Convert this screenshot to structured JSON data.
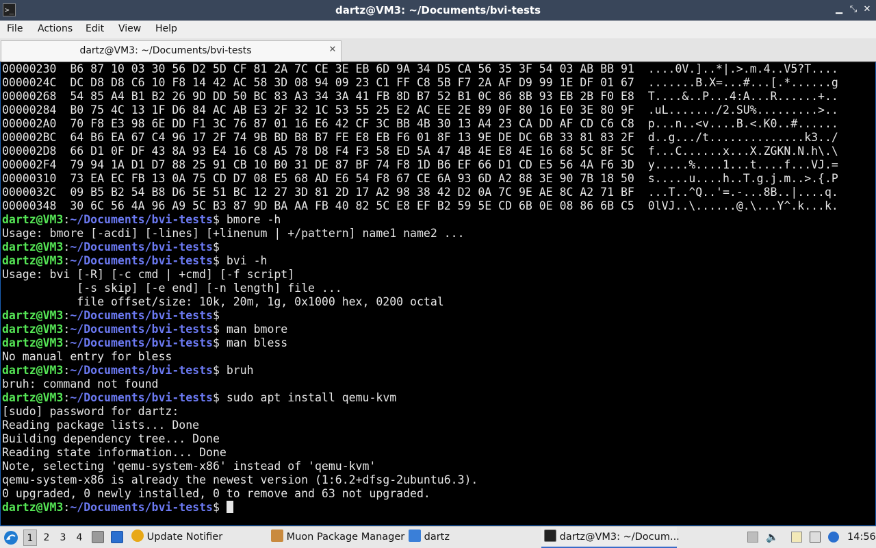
{
  "window": {
    "title": "dartz@VM3: ~/Documents/bvi-tests",
    "app_icon": "terminal-icon",
    "controls": [
      "minimize-icon",
      "maximize-icon",
      "close-icon"
    ]
  },
  "menu": [
    "File",
    "Actions",
    "Edit",
    "View",
    "Help"
  ],
  "tab": {
    "label": "dartz@VM3: ~/Documents/bvi-tests",
    "close_icon": "close-icon"
  },
  "prompt": {
    "user": "dartz@VM3",
    "sep": ":",
    "path": "~/Documents/bvi-tests",
    "dollar": "$"
  },
  "hex_lines": [
    "00000230  B6 87 10 03 30 56 D2 5D CF 81 2A 7C CE 3E EB 6D 9A 34 D5 CA 56 35 3F 54 03 AB BB 91  ....0V.]..*|.>.m.4..V5?T....",
    "0000024C  DC D8 D8 C6 10 F8 14 42 AC 58 3D 08 94 09 23 C1 FF C8 5B F7 2A AF D9 99 1E DF 01 67  .......B.X=...#...[.*......g",
    "00000268  54 85 A4 B1 B2 26 9D DD 50 BC 83 A3 34 3A 41 FB 8D B7 52 B1 0C 86 8B 93 EB 2B F0 E8  T....&..P...4:A...R......+..",
    "00000284  B0 75 4C 13 1F D6 84 AC AB E3 2F 32 1C 53 55 25 E2 AC EE 2E 89 0F 80 16 E0 3E 80 9F  .uL......./2.SU%.........>..",
    "000002A0  70 F8 E3 98 6E DD F1 3C 76 87 01 16 E6 42 CF 3C BB 4B 30 13 A4 23 CA DD AF CD C6 C8  p...n..<v....B.<.K0..#......",
    "000002BC  64 B6 EA 67 C4 96 17 2F 74 9B BD B8 B7 FE E8 EB F6 01 8F 13 9E DE DC 6B 33 81 83 2F  d..g.../t..............k3../",
    "000002D8  66 D1 0F DF 43 8A 93 E4 16 C8 A5 78 D8 F4 F3 58 ED 5A 47 4B 4E E8 4E 16 68 5C 8F 5C  f...C......x...X.ZGKN.N.h\\.\\",
    "000002F4  79 94 1A D1 D7 88 25 91 CB 10 B0 31 DE 87 BF 74 F8 1D B6 EF 66 D1 CD E5 56 4A F6 3D  y.....%....1...t....f...VJ.=",
    "00000310  73 EA EC FB 13 0A 75 CD D7 08 E5 68 AD E6 54 F8 67 CE 6A 93 6D A2 88 3E 90 7B 18 50  s.....u....h..T.g.j.m..>.{.P",
    "0000032C  09 B5 B2 54 B8 D6 5E 51 BC 12 27 3D 81 2D 17 A2 98 38 42 D2 0A 7C 9E AE 8C A2 71 BF  ...T..^Q..'=.-...8B..|....q.",
    "00000348  30 6C 56 4A 96 A9 5C B3 87 9D BA AA FB 40 82 5C E8 EF B2 59 5E CD 6B 0E 08 86 6B C5  0lVJ..\\......@.\\...Y^.k...k."
  ],
  "session": [
    {
      "type": "prompt",
      "cmd": " bmore -h"
    },
    {
      "type": "out",
      "text": "Usage: bmore [-acdi] [-lines] [+linenum | +/pattern] name1 name2 ..."
    },
    {
      "type": "prompt",
      "cmd": ""
    },
    {
      "type": "prompt",
      "cmd": " bvi -h"
    },
    {
      "type": "out",
      "text": "Usage: bvi [-R] [-c cmd | +cmd] [-f script]"
    },
    {
      "type": "out",
      "text": "           [-s skip] [-e end] [-n length] file ..."
    },
    {
      "type": "out",
      "text": "           file offset/size: 10k, 20m, 1g, 0x1000 hex, 0200 octal"
    },
    {
      "type": "prompt",
      "cmd": ""
    },
    {
      "type": "prompt",
      "cmd": " man bmore"
    },
    {
      "type": "prompt",
      "cmd": " man bless"
    },
    {
      "type": "out",
      "text": "No manual entry for bless"
    },
    {
      "type": "prompt",
      "cmd": " bruh"
    },
    {
      "type": "out",
      "text": "bruh: command not found"
    },
    {
      "type": "prompt",
      "cmd": " sudo apt install qemu-kvm"
    },
    {
      "type": "out",
      "text": "[sudo] password for dartz:"
    },
    {
      "type": "out",
      "text": "Reading package lists... Done"
    },
    {
      "type": "out",
      "text": "Building dependency tree... Done"
    },
    {
      "type": "out",
      "text": "Reading state information... Done"
    },
    {
      "type": "out",
      "text": "Note, selecting 'qemu-system-x86' instead of 'qemu-kvm'"
    },
    {
      "type": "out",
      "text": "qemu-system-x86 is already the newest version (1:6.2+dfsg-2ubuntu6.3)."
    },
    {
      "type": "out",
      "text": "0 upgraded, 0 newly installed, 0 to remove and 63 not upgraded."
    },
    {
      "type": "prompt",
      "cmd": " ",
      "cursor": true
    }
  ],
  "taskbar": {
    "start_icon": "lubuntu-logo-icon",
    "workspaces": [
      "1",
      "2",
      "3",
      "4"
    ],
    "active_workspace": "1",
    "quick_icons": [
      "file-manager-icon",
      "desktop-icon"
    ],
    "tasks": [
      {
        "label": "Update Notifier",
        "icon": "update-notifier-icon"
      },
      {
        "label": "Muon Package Manager",
        "icon": "package-manager-icon"
      },
      {
        "label": "dartz",
        "icon": "folder-icon"
      },
      {
        "label": "dartz@VM3: ~/Docum...",
        "icon": "terminal-icon",
        "active": true
      }
    ],
    "tray_icons": [
      "eject-icon",
      "volume-icon",
      "clipboard-icon",
      "network-icon",
      "update-tray-icon"
    ],
    "clock": "14:56"
  },
  "colors": {
    "titlebar": "#39465a",
    "prompt_user": "#55e655",
    "prompt_path": "#6b79f2",
    "terminal_bg": "#000000",
    "terminal_fg": "#e6e6e6"
  }
}
